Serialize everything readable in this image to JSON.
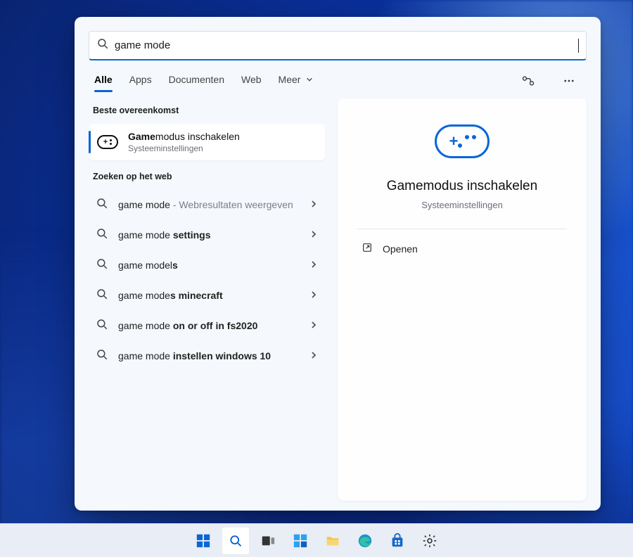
{
  "searchbox": {
    "value": "game mode"
  },
  "tabs": {
    "all": "Alle",
    "apps": "Apps",
    "documents": "Documenten",
    "web": "Web",
    "more": "Meer"
  },
  "sections": {
    "best_match": "Beste overeenkomst",
    "web_search": "Zoeken op het web"
  },
  "best_match": {
    "title_bold": "Game",
    "title_rest": "modus inschakelen",
    "subtitle": "Systeeminstellingen"
  },
  "web_results": [
    {
      "prefix": "game mode",
      "bold": "",
      "suffix": " - Webresultaten weergeven",
      "suffix_muted": true
    },
    {
      "prefix": "game mode ",
      "bold": "settings",
      "suffix": ""
    },
    {
      "prefix": "game model",
      "bold": "s",
      "suffix": ""
    },
    {
      "prefix": "game mode",
      "bold": "s minecraft",
      "suffix": ""
    },
    {
      "prefix": "game mode ",
      "bold": "on or off in fs2020",
      "suffix": ""
    },
    {
      "prefix": "game mode ",
      "bold": "instellen windows 10",
      "suffix": ""
    }
  ],
  "preview": {
    "title": "Gamemodus inschakelen",
    "subtitle": "Systeeminstellingen",
    "action_open": "Openen"
  },
  "taskbar": {
    "items": [
      "start",
      "search",
      "taskview",
      "widgets",
      "explorer",
      "edge",
      "store",
      "settings"
    ]
  }
}
